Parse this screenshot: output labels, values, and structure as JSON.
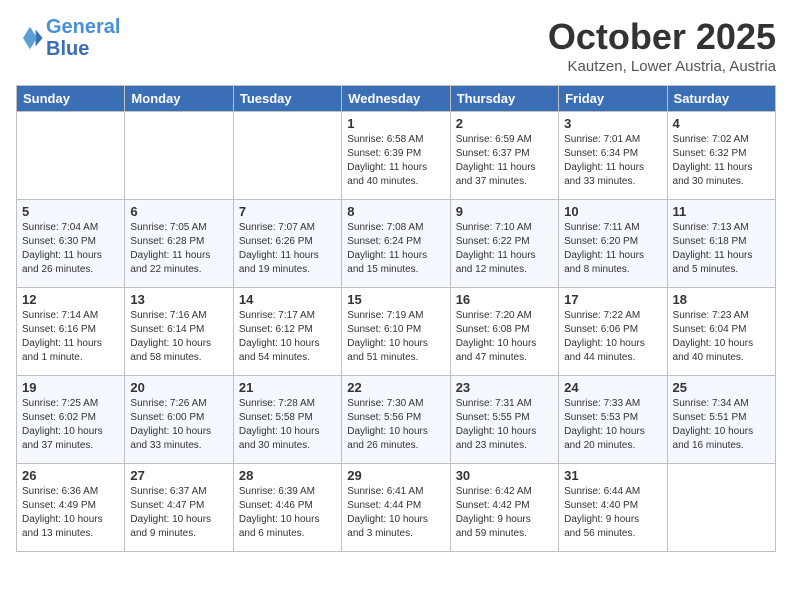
{
  "header": {
    "logo_line1": "General",
    "logo_line2": "Blue",
    "title": "October 2025",
    "subtitle": "Kautzen, Lower Austria, Austria"
  },
  "days_of_week": [
    "Sunday",
    "Monday",
    "Tuesday",
    "Wednesday",
    "Thursday",
    "Friday",
    "Saturday"
  ],
  "weeks": [
    [
      {
        "day": "",
        "info": ""
      },
      {
        "day": "",
        "info": ""
      },
      {
        "day": "",
        "info": ""
      },
      {
        "day": "1",
        "info": "Sunrise: 6:58 AM\nSunset: 6:39 PM\nDaylight: 11 hours\nand 40 minutes."
      },
      {
        "day": "2",
        "info": "Sunrise: 6:59 AM\nSunset: 6:37 PM\nDaylight: 11 hours\nand 37 minutes."
      },
      {
        "day": "3",
        "info": "Sunrise: 7:01 AM\nSunset: 6:34 PM\nDaylight: 11 hours\nand 33 minutes."
      },
      {
        "day": "4",
        "info": "Sunrise: 7:02 AM\nSunset: 6:32 PM\nDaylight: 11 hours\nand 30 minutes."
      }
    ],
    [
      {
        "day": "5",
        "info": "Sunrise: 7:04 AM\nSunset: 6:30 PM\nDaylight: 11 hours\nand 26 minutes."
      },
      {
        "day": "6",
        "info": "Sunrise: 7:05 AM\nSunset: 6:28 PM\nDaylight: 11 hours\nand 22 minutes."
      },
      {
        "day": "7",
        "info": "Sunrise: 7:07 AM\nSunset: 6:26 PM\nDaylight: 11 hours\nand 19 minutes."
      },
      {
        "day": "8",
        "info": "Sunrise: 7:08 AM\nSunset: 6:24 PM\nDaylight: 11 hours\nand 15 minutes."
      },
      {
        "day": "9",
        "info": "Sunrise: 7:10 AM\nSunset: 6:22 PM\nDaylight: 11 hours\nand 12 minutes."
      },
      {
        "day": "10",
        "info": "Sunrise: 7:11 AM\nSunset: 6:20 PM\nDaylight: 11 hours\nand 8 minutes."
      },
      {
        "day": "11",
        "info": "Sunrise: 7:13 AM\nSunset: 6:18 PM\nDaylight: 11 hours\nand 5 minutes."
      }
    ],
    [
      {
        "day": "12",
        "info": "Sunrise: 7:14 AM\nSunset: 6:16 PM\nDaylight: 11 hours\nand 1 minute."
      },
      {
        "day": "13",
        "info": "Sunrise: 7:16 AM\nSunset: 6:14 PM\nDaylight: 10 hours\nand 58 minutes."
      },
      {
        "day": "14",
        "info": "Sunrise: 7:17 AM\nSunset: 6:12 PM\nDaylight: 10 hours\nand 54 minutes."
      },
      {
        "day": "15",
        "info": "Sunrise: 7:19 AM\nSunset: 6:10 PM\nDaylight: 10 hours\nand 51 minutes."
      },
      {
        "day": "16",
        "info": "Sunrise: 7:20 AM\nSunset: 6:08 PM\nDaylight: 10 hours\nand 47 minutes."
      },
      {
        "day": "17",
        "info": "Sunrise: 7:22 AM\nSunset: 6:06 PM\nDaylight: 10 hours\nand 44 minutes."
      },
      {
        "day": "18",
        "info": "Sunrise: 7:23 AM\nSunset: 6:04 PM\nDaylight: 10 hours\nand 40 minutes."
      }
    ],
    [
      {
        "day": "19",
        "info": "Sunrise: 7:25 AM\nSunset: 6:02 PM\nDaylight: 10 hours\nand 37 minutes."
      },
      {
        "day": "20",
        "info": "Sunrise: 7:26 AM\nSunset: 6:00 PM\nDaylight: 10 hours\nand 33 minutes."
      },
      {
        "day": "21",
        "info": "Sunrise: 7:28 AM\nSunset: 5:58 PM\nDaylight: 10 hours\nand 30 minutes."
      },
      {
        "day": "22",
        "info": "Sunrise: 7:30 AM\nSunset: 5:56 PM\nDaylight: 10 hours\nand 26 minutes."
      },
      {
        "day": "23",
        "info": "Sunrise: 7:31 AM\nSunset: 5:55 PM\nDaylight: 10 hours\nand 23 minutes."
      },
      {
        "day": "24",
        "info": "Sunrise: 7:33 AM\nSunset: 5:53 PM\nDaylight: 10 hours\nand 20 minutes."
      },
      {
        "day": "25",
        "info": "Sunrise: 7:34 AM\nSunset: 5:51 PM\nDaylight: 10 hours\nand 16 minutes."
      }
    ],
    [
      {
        "day": "26",
        "info": "Sunrise: 6:36 AM\nSunset: 4:49 PM\nDaylight: 10 hours\nand 13 minutes."
      },
      {
        "day": "27",
        "info": "Sunrise: 6:37 AM\nSunset: 4:47 PM\nDaylight: 10 hours\nand 9 minutes."
      },
      {
        "day": "28",
        "info": "Sunrise: 6:39 AM\nSunset: 4:46 PM\nDaylight: 10 hours\nand 6 minutes."
      },
      {
        "day": "29",
        "info": "Sunrise: 6:41 AM\nSunset: 4:44 PM\nDaylight: 10 hours\nand 3 minutes."
      },
      {
        "day": "30",
        "info": "Sunrise: 6:42 AM\nSunset: 4:42 PM\nDaylight: 9 hours\nand 59 minutes."
      },
      {
        "day": "31",
        "info": "Sunrise: 6:44 AM\nSunset: 4:40 PM\nDaylight: 9 hours\nand 56 minutes."
      },
      {
        "day": "",
        "info": ""
      }
    ]
  ]
}
